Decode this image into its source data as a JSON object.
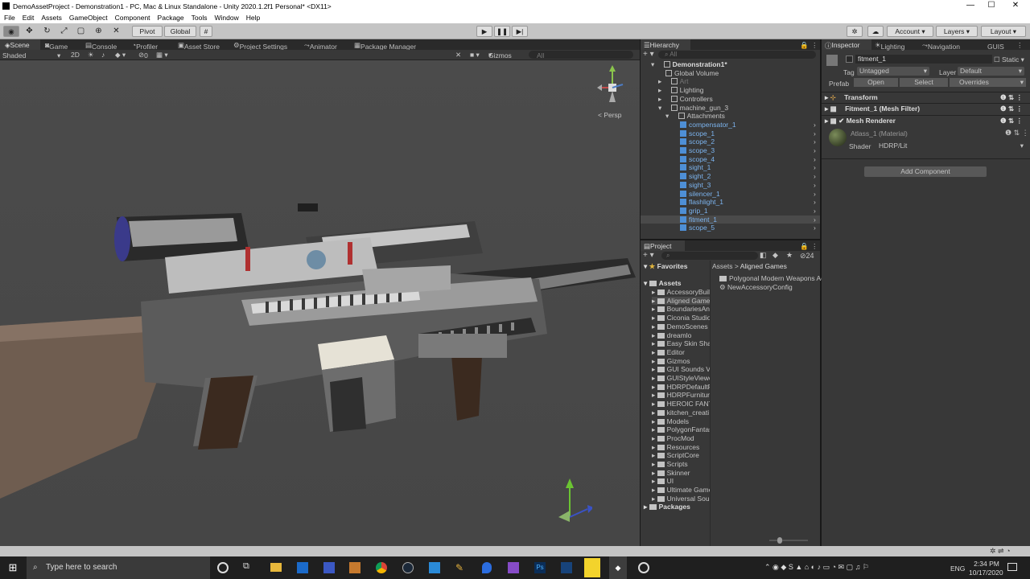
{
  "window": {
    "title": "DemoAssetProject - Demonstration1 - PC, Mac & Linux Standalone - Unity 2020.1.2f1 Personal* <DX11>",
    "minimize": "—",
    "maximize": "☐",
    "close": "✕"
  },
  "menu": [
    "File",
    "Edit",
    "Assets",
    "GameObject",
    "Component",
    "Package",
    "Tools",
    "Window",
    "Help"
  ],
  "toolbar": {
    "pivot": "Pivot",
    "global": "Global",
    "account": "Account",
    "layers": "Layers",
    "layout": "Layout"
  },
  "scene_tabs": {
    "scene": "Scene",
    "game": "Game",
    "console": "Console",
    "profiler": "Profiler",
    "asset_store": "Asset Store",
    "project_settings": "Project Settings",
    "animator": "Animator",
    "package_manager": "Package Manager"
  },
  "scene_toolbar": {
    "shading": "Shaded",
    "mode_2d": "2D",
    "layer_count": "0",
    "gizmos": "Gizmos",
    "search_placeholder": "All"
  },
  "gizmo": {
    "persp": "< Persp"
  },
  "hierarchy": {
    "tab": "Hierarchy",
    "search_placeholder": "All",
    "items": [
      {
        "label": "Demonstration1*",
        "depth": 0,
        "kind": "scene",
        "selected": false
      },
      {
        "label": "Global Volume",
        "depth": 1,
        "kind": "obj"
      },
      {
        "label": "Art",
        "depth": 1,
        "kind": "obj",
        "dim": true
      },
      {
        "label": "Lighting",
        "depth": 1,
        "kind": "obj"
      },
      {
        "label": "Controllers",
        "depth": 1,
        "kind": "obj"
      },
      {
        "label": "machine_gun_3",
        "depth": 1,
        "kind": "obj"
      },
      {
        "label": "Attachments",
        "depth": 2,
        "kind": "obj"
      },
      {
        "label": "compensator_1",
        "depth": 3,
        "kind": "prefab"
      },
      {
        "label": "scope_1",
        "depth": 3,
        "kind": "prefab"
      },
      {
        "label": "scope_2",
        "depth": 3,
        "kind": "prefab"
      },
      {
        "label": "scope_3",
        "depth": 3,
        "kind": "prefab"
      },
      {
        "label": "scope_4",
        "depth": 3,
        "kind": "prefab"
      },
      {
        "label": "sight_1",
        "depth": 3,
        "kind": "prefab"
      },
      {
        "label": "sight_2",
        "depth": 3,
        "kind": "prefab"
      },
      {
        "label": "sight_3",
        "depth": 3,
        "kind": "prefab"
      },
      {
        "label": "silencer_1",
        "depth": 3,
        "kind": "prefab"
      },
      {
        "label": "flashlight_1",
        "depth": 3,
        "kind": "prefab"
      },
      {
        "label": "grip_1",
        "depth": 3,
        "kind": "prefab"
      },
      {
        "label": "fitment_1",
        "depth": 3,
        "kind": "prefab",
        "selected": true
      },
      {
        "label": "scope_5",
        "depth": 3,
        "kind": "prefab"
      }
    ]
  },
  "inspector": {
    "tabs": {
      "inspector": "Inspector",
      "lighting": "Lighting",
      "navigation": "Navigation",
      "gui": "GUIS"
    },
    "object_name": "fitment_1",
    "static": "Static",
    "tag_label": "Tag",
    "tag_value": "Untagged",
    "layer_label": "Layer",
    "layer_value": "Default",
    "prefab_label": "Prefab",
    "open": "Open",
    "select": "Select",
    "overrides": "Overrides",
    "components": [
      "Transform",
      "Fitment_1 (Mesh Filter)",
      "Mesh Renderer"
    ],
    "material": "Atlass_1 (Material)",
    "shader_label": "Shader",
    "shader_value": "HDRP/Lit",
    "add_component": "Add Component"
  },
  "project": {
    "tab": "Project",
    "favorites": "Favorites",
    "breadcrumb_root": "Assets",
    "breadcrumb_child": "Aligned Games",
    "count": "24",
    "assets_root": "Assets",
    "folders": [
      "AccessoryBuil",
      "Aligned Games",
      "BoundariesAnd",
      "Ciconia Studio",
      "DemoScenes",
      "dreamlo",
      "Easy Skin Sha",
      "Editor",
      "Gizmos",
      "GUI Sounds Vo",
      "GUIStyleViewe",
      "HDRPDefaultR",
      "HDRPFurniture",
      "HEROIC FANT",
      "kitchen_creati",
      "Models",
      "PolygonFantas",
      "ProcMod",
      "Resources",
      "ScriptCore",
      "Scripts",
      "Skinner",
      "UI",
      "Ultimate Game",
      "Universal Sou"
    ],
    "packages": "Packages",
    "files": [
      "Polygonal Modern Weapons Ac",
      "NewAccessoryConfig"
    ]
  },
  "taskbar": {
    "search": "Type here to search",
    "time": "2:34 PM",
    "date": "10/17/2020",
    "lang": "ENG"
  }
}
